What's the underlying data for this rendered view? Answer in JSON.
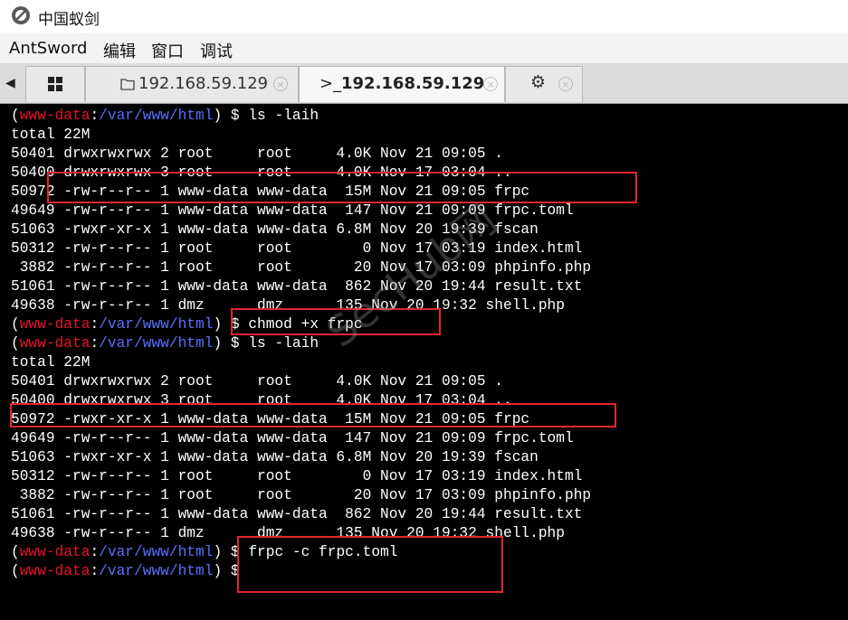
{
  "window": {
    "title": "中国蚁剑"
  },
  "menu": {
    "items": [
      "AntSword",
      "编辑",
      "窗口",
      "调试"
    ]
  },
  "tabs": [
    {
      "icon": "grid-icon",
      "label": ""
    },
    {
      "icon": "folder-icon",
      "label": "192.168.59.129",
      "close": "×"
    },
    {
      "icon": "terminal-icon",
      "prefix": ">_",
      "label": "192.168.59.129",
      "close": "×"
    },
    {
      "icon": "gear-icon",
      "label": "",
      "close": "×"
    }
  ],
  "terminal": {
    "prompt": {
      "open": "(",
      "user": "www-data",
      "sep": ":",
      "path": "/var/www/html",
      "close": ")",
      "sign": " $ "
    },
    "lines": [
      {
        "type": "prompt",
        "cmd": "ls -laih"
      },
      {
        "type": "out",
        "text": "total 22M"
      },
      {
        "type": "out",
        "text": "50401 drwxrwxrwx 2 root     root     4.0K Nov 21 09:05 ."
      },
      {
        "type": "out",
        "text": "50400 drwxrwxrwx 3 root     root     4.0K Nov 17 03:04 .."
      },
      {
        "type": "out",
        "text": "50972 -rw-r--r-- 1 www-data www-data  15M Nov 21 09:05 frpc"
      },
      {
        "type": "out",
        "text": "49649 -rw-r--r-- 1 www-data www-data  147 Nov 21 09:09 frpc.toml"
      },
      {
        "type": "out",
        "text": "51063 -rwxr-xr-x 1 www-data www-data 6.8M Nov 20 19:39 fscan"
      },
      {
        "type": "out",
        "text": "50312 -rw-r--r-- 1 root     root        0 Nov 17 03:19 index.html"
      },
      {
        "type": "out",
        "text": " 3882 -rw-r--r-- 1 root     root       20 Nov 17 03:09 phpinfo.php"
      },
      {
        "type": "out",
        "text": "51061 -rw-r--r-- 1 www-data www-data  862 Nov 20 19:44 result.txt"
      },
      {
        "type": "out",
        "text": "49638 -rw-r--r-- 1 dmz      dmz      135 Nov 20 19:32 shell.php"
      },
      {
        "type": "prompt",
        "cmd": "chmod +x frpc"
      },
      {
        "type": "prompt",
        "cmd": "ls -laih"
      },
      {
        "type": "out",
        "text": "total 22M"
      },
      {
        "type": "out",
        "text": "50401 drwxrwxrwx 2 root     root     4.0K Nov 21 09:05 ."
      },
      {
        "type": "out",
        "text": "50400 drwxrwxrwx 3 root     root     4.0K Nov 17 03:04 .."
      },
      {
        "type": "out",
        "text": "50972 -rwxr-xr-x 1 www-data www-data  15M Nov 21 09:05 frpc"
      },
      {
        "type": "out",
        "text": "49649 -rw-r--r-- 1 www-data www-data  147 Nov 21 09:09 frpc.toml"
      },
      {
        "type": "out",
        "text": "51063 -rwxr-xr-x 1 www-data www-data 6.8M Nov 20 19:39 fscan"
      },
      {
        "type": "out",
        "text": "50312 -rw-r--r-- 1 root     root        0 Nov 17 03:19 index.html"
      },
      {
        "type": "out",
        "text": " 3882 -rw-r--r-- 1 root     root       20 Nov 17 03:09 phpinfo.php"
      },
      {
        "type": "out",
        "text": "51061 -rw-r--r-- 1 www-data www-data  862 Nov 20 19:44 result.txt"
      },
      {
        "type": "out",
        "text": "49638 -rw-r--r-- 1 dmz      dmz      135 Nov 20 19:32 shell.php"
      },
      {
        "type": "prompt",
        "cmd": "frpc -c frpc.toml"
      },
      {
        "type": "prompt",
        "cmd": ""
      }
    ]
  },
  "watermark": "SecHub网",
  "colors": {
    "prompt_user": "#e8112d",
    "prompt_path": "#5a6fff",
    "highlight": "#e2262f",
    "terminal_bg": "#000000"
  }
}
